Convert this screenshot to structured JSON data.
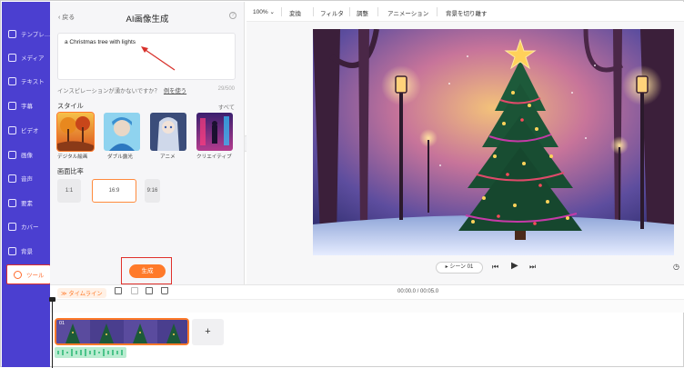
{
  "left_nav": {
    "items": [
      {
        "label": "テンプレ…",
        "icon": "template-icon"
      },
      {
        "label": "メディア",
        "icon": "media-icon"
      },
      {
        "label": "テキスト",
        "icon": "text-icon"
      },
      {
        "label": "字幕",
        "icon": "subtitle-icon"
      },
      {
        "label": "ビデオ",
        "icon": "video-icon"
      },
      {
        "label": "画像",
        "icon": "image-icon"
      },
      {
        "label": "音声",
        "icon": "audio-icon"
      },
      {
        "label": "要素",
        "icon": "element-icon"
      },
      {
        "label": "カバー",
        "icon": "cover-icon"
      },
      {
        "label": "背景",
        "icon": "background-icon"
      },
      {
        "label": "ツール",
        "icon": "tools-icon",
        "active": true
      }
    ]
  },
  "panel": {
    "back_label": "戻る",
    "title": "AI画像生成",
    "prompt_text": "a Christmas tree with lights",
    "inspiration_text": "インスピレーションが湧かないですか？",
    "example_link": "例を使う",
    "char_counter": "29/500",
    "style_section": "スタイル",
    "see_all": "すべて",
    "styles": [
      {
        "name": "デジタル絵画",
        "selected": true
      },
      {
        "name": "ダブル露光",
        "selected": false
      },
      {
        "name": "アニメ",
        "selected": false
      },
      {
        "name": "クリエイティブ",
        "selected": false
      }
    ],
    "ratio_section": "画面比率",
    "ratios": [
      {
        "label": "1:1",
        "selected": false
      },
      {
        "label": "16:9",
        "selected": true
      },
      {
        "label": "9:16",
        "selected": false
      }
    ],
    "generate_label": "生成"
  },
  "toolbar": {
    "zoom": "100%",
    "items": [
      "変換",
      "フィルタ",
      "調整",
      "アニメーション",
      "背景を切り離す"
    ]
  },
  "player": {
    "scene_label": "シーン 01"
  },
  "timeline": {
    "label": "タイムライン",
    "time": "00:00.0 / 00:05.0",
    "clip_number": "01",
    "add_label": "+"
  },
  "colors": {
    "nav_bg": "#4b3fd0",
    "accent": "#ff7a2a",
    "highlight_box": "#e0302b"
  }
}
